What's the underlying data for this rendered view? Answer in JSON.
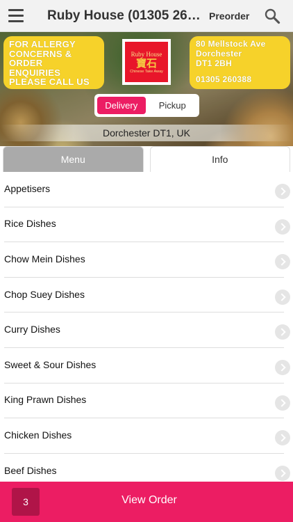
{
  "header": {
    "title": "Ruby House (01305 260..",
    "preorder_label": "Preorder"
  },
  "banner": {
    "left_note": [
      "FOR ALLERGY",
      "CONCERNS &",
      "ORDER",
      "ENQUIRIES",
      "PLEASE CALL US"
    ],
    "right_note": [
      "80 Mellstock Ave",
      "Dorchester",
      "DT1 2BH"
    ],
    "right_phone": "01305 260388",
    "logo": {
      "name": "Ruby House",
      "glyph": "寶石",
      "subtitle": "Chinese Take Away"
    },
    "order_type": {
      "delivery": "Delivery",
      "pickup": "Pickup",
      "selected": "Delivery"
    },
    "location": "Dorchester DT1, UK"
  },
  "tabs": [
    {
      "label": "Menu",
      "active": true
    },
    {
      "label": "Info",
      "active": false
    }
  ],
  "menu": {
    "categories": [
      "Appetisers",
      "Rice Dishes",
      "Chow Mein Dishes",
      "Chop Suey Dishes",
      "Curry Dishes",
      "Sweet & Sour Dishes",
      "King Prawn Dishes",
      "Chicken Dishes",
      "Beef Dishes"
    ]
  },
  "footer": {
    "item_count": "3",
    "view_order_label": "View Order"
  },
  "colors": {
    "accent": "#ec1d63",
    "badge": "#b01448",
    "note_yellow": "#f6d22a",
    "logo_red": "#e8162a"
  },
  "icons": {
    "menu": "hamburger-icon",
    "search": "search-icon",
    "chevron": "chevron-right-icon"
  }
}
